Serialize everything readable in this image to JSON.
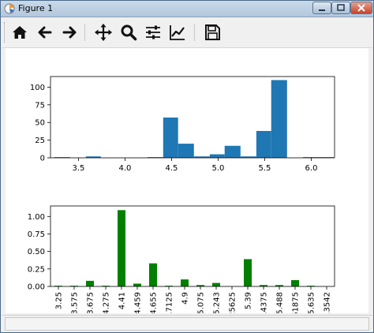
{
  "window": {
    "title": "Figure 1"
  },
  "titlebar_buttons": {
    "minimize_icon": "minimize-icon",
    "maximize_icon": "maximize-icon",
    "close_icon": "close-icon"
  },
  "toolbar": {
    "buttons": [
      {
        "name": "home-icon"
      },
      {
        "name": "back-arrow-icon"
      },
      {
        "name": "forward-arrow-icon"
      },
      {
        "name": "pan-icon"
      },
      {
        "name": "zoom-icon"
      },
      {
        "name": "subplots-config-icon"
      },
      {
        "name": "edit-axis-icon"
      },
      {
        "name": "save-icon"
      }
    ]
  },
  "chart_data": [
    {
      "type": "bar",
      "x_ticks": [
        "3.5",
        "4.0",
        "4.5",
        "5.0",
        "5.5",
        "6.0"
      ],
      "y_ticks": [
        "0",
        "25",
        "50",
        "75",
        "100"
      ],
      "xlim": [
        3.2,
        6.25
      ],
      "ylim": [
        0,
        115
      ],
      "bins": [
        {
          "x0": 3.24,
          "x1": 3.41,
          "value": 1
        },
        {
          "x0": 3.58,
          "x1": 3.74,
          "value": 2
        },
        {
          "x0": 4.24,
          "x1": 4.41,
          "value": 1
        },
        {
          "x0": 4.41,
          "x1": 4.57,
          "value": 57
        },
        {
          "x0": 4.57,
          "x1": 4.74,
          "value": 20
        },
        {
          "x0": 4.74,
          "x1": 4.91,
          "value": 2
        },
        {
          "x0": 4.91,
          "x1": 5.07,
          "value": 5
        },
        {
          "x0": 5.07,
          "x1": 5.24,
          "value": 17
        },
        {
          "x0": 5.24,
          "x1": 5.41,
          "value": 2
        },
        {
          "x0": 5.41,
          "x1": 5.57,
          "value": 38
        },
        {
          "x0": 5.57,
          "x1": 5.74,
          "value": 110
        },
        {
          "x0": 5.91,
          "x1": 6.07,
          "value": 1
        },
        {
          "x0": 6.07,
          "x1": 6.24,
          "value": 1
        }
      ],
      "color": "#1f77b4"
    },
    {
      "type": "bar",
      "categories": [
        "3.25",
        "3.575",
        "3.675",
        "4.275",
        "4.41",
        "4.459",
        "4.655",
        "4.7125",
        "4.9",
        "5.075",
        "5.243",
        "25625",
        "5.39",
        "6.4375",
        "5.488",
        "61875",
        "5.635",
        "13542"
      ],
      "values": [
        0.01,
        0.01,
        0.08,
        0.01,
        1.09,
        0.04,
        0.33,
        0.01,
        0.1,
        0.02,
        0.05,
        0.0,
        0.39,
        0.02,
        0.02,
        0.09,
        0.01,
        0.0
      ],
      "y_ticks": [
        "0.00",
        "0.25",
        "0.50",
        "0.75",
        "1.00"
      ],
      "ylim": [
        0,
        1.15
      ],
      "color": "#008000"
    }
  ]
}
